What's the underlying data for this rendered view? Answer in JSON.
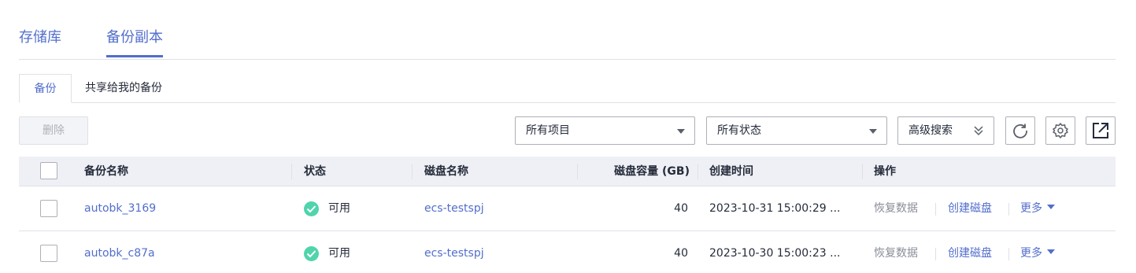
{
  "top_tabs": [
    {
      "label": "存储库"
    },
    {
      "label": "备份副本"
    }
  ],
  "sub_tabs": [
    {
      "label": "备份"
    },
    {
      "label": "共享给我的备份"
    }
  ],
  "toolbar": {
    "delete_label": "删除",
    "project_select": "所有项目",
    "status_select": "所有状态",
    "advanced_search": "高级搜索",
    "icons": [
      "refresh-icon",
      "gear-icon",
      "export-icon"
    ]
  },
  "table": {
    "headers": {
      "name": "备份名称",
      "status": "状态",
      "disk_name": "磁盘名称",
      "capacity": "磁盘容量 (GB)",
      "created": "创建时间",
      "actions": "操作"
    },
    "rows": [
      {
        "name": "autobk_3169",
        "status": "可用",
        "disk_name": "ecs-testspj",
        "capacity": "40",
        "created": "2023-10-31 15:00:29 ...",
        "action_restore": "恢复数据",
        "action_create_disk": "创建磁盘",
        "action_more": "更多"
      },
      {
        "name": "autobk_c87a",
        "status": "可用",
        "disk_name": "ecs-testspj",
        "capacity": "40",
        "created": "2023-10-30 15:00:23 ...",
        "action_restore": "恢复数据",
        "action_create_disk": "创建磁盘",
        "action_more": "更多"
      }
    ]
  },
  "colors": {
    "accent": "#526ecc",
    "status_ok": "#50d4ab",
    "header_bg": "#eef0f5",
    "muted": "#8a8e99"
  }
}
